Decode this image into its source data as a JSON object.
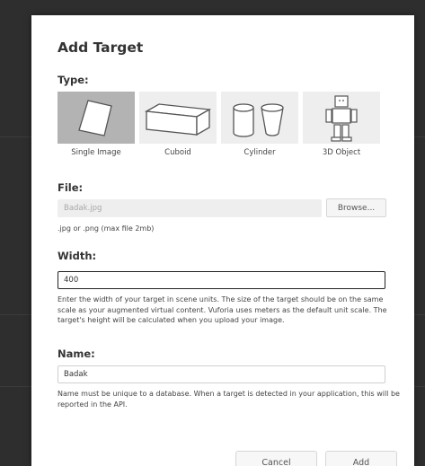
{
  "dialog": {
    "title": "Add Target",
    "type_section": {
      "label": "Type:",
      "options": [
        {
          "label": "Single Image",
          "icon": "single-image-icon",
          "selected": true
        },
        {
          "label": "Cuboid",
          "icon": "cuboid-icon",
          "selected": false
        },
        {
          "label": "Cylinder",
          "icon": "cylinder-icon",
          "selected": false
        },
        {
          "label": "3D Object",
          "icon": "3d-object-icon",
          "selected": false
        }
      ]
    },
    "file_section": {
      "label": "File:",
      "value": "Badak.jpg",
      "browse_label": "Browse...",
      "hint": ".jpg or .png (max file 2mb)"
    },
    "width_section": {
      "label": "Width:",
      "value": "400",
      "hint": "Enter the width of your target in scene units. The size of the target should be on the same scale as your augmented virtual content. Vuforia uses meters as the default unit scale. The target's height will be calculated when you upload your image."
    },
    "name_section": {
      "label": "Name:",
      "value": "Badak",
      "hint": "Name must be unique to a database. When a target is detected in your application, this will be reported in the API."
    },
    "footer": {
      "cancel_label": "Cancel",
      "add_label": "Add"
    }
  },
  "colors": {
    "selected_tile": "#b3b3b3",
    "tile": "#eeeeee",
    "backdrop": "#2e2e2e"
  }
}
